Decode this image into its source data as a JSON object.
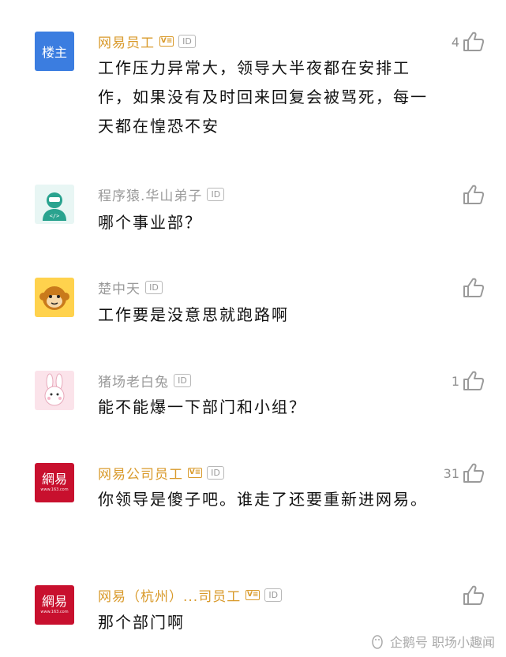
{
  "comments": [
    {
      "avatar": "楼主",
      "name": "网易员工",
      "text": "工作压力异常大，领导大半夜都在安排工作，如果没有及时回来回复会被骂死，每一天都在惶恐不安",
      "likes": "4"
    },
    {
      "avatar": "",
      "name": "程序猿.华山弟子",
      "text": "哪个事业部？",
      "likes": ""
    },
    {
      "avatar": "",
      "name": "楚中天",
      "text": "工作要是没意思就跑路啊",
      "likes": ""
    },
    {
      "avatar": "",
      "name": "猪场老白兔",
      "text": "能不能爆一下部门和小组？",
      "likes": "1"
    },
    {
      "avatar": "網易",
      "avatar_sub": "www.163.com",
      "name": "网易公司员工",
      "text": "你领导是傻子吧。谁走了还要重新进网易。",
      "likes": "31"
    },
    {
      "avatar": "網易",
      "avatar_sub": "www.163.com",
      "name": "网易（杭州）...司员工",
      "text": "那个部门啊",
      "likes": ""
    }
  ],
  "badges": {
    "v": "V≡",
    "id": "ID"
  },
  "watermark": {
    "text": "企鹅号 职场小趣闻"
  },
  "icons": {
    "like": "thumbs-up-icon",
    "watermark": "penguin-icon"
  },
  "colors": {
    "name_gold": "#d99a2b",
    "name_gray": "#9a9a9a",
    "netease_red": "#c8102e",
    "op_blue": "#3b7de0"
  }
}
